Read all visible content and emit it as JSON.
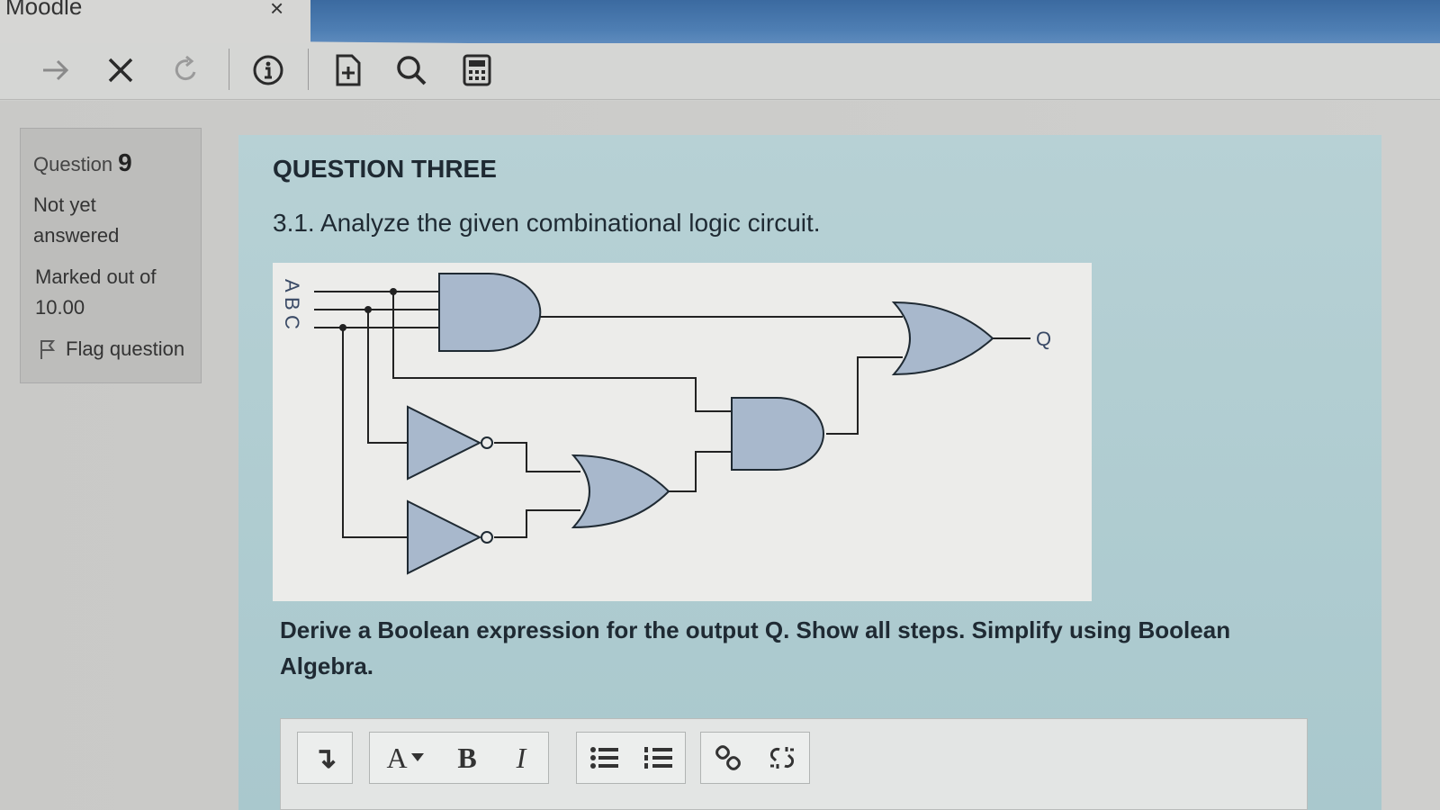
{
  "window": {
    "app_title": "Moodle",
    "close_tab_glyph": "×"
  },
  "toolbar": {
    "forward_icon": "arrow-right-icon",
    "stop_icon": "close-icon",
    "reload_icon": "reload-icon",
    "info_icon": "info-icon",
    "page_icon": "add-page-icon",
    "search_icon": "search-icon",
    "calculator_icon": "calculator-icon"
  },
  "question_info": {
    "label": "Question",
    "number": "9",
    "status": "Not yet answered",
    "marked": "Marked out of 10.00",
    "flag": "Flag question"
  },
  "question": {
    "heading": "QUESTION THREE",
    "subtitle": "3.1. Analyze the given combinational logic circuit.",
    "instruction": "Derive a Boolean expression for the output Q. Show all steps. Simplify using Boolean Algebra."
  },
  "circuit": {
    "inputs": [
      "A",
      "B",
      "C"
    ],
    "output": "Q"
  },
  "editor": {
    "expand_label": "↴",
    "font_label": "A",
    "bold_label": "B",
    "italic_label": "I"
  },
  "colors": {
    "gate_fill": "#a8b8cc",
    "question_bg": "#b7d1d5",
    "titlebar_blue": "#4f7fb4"
  }
}
